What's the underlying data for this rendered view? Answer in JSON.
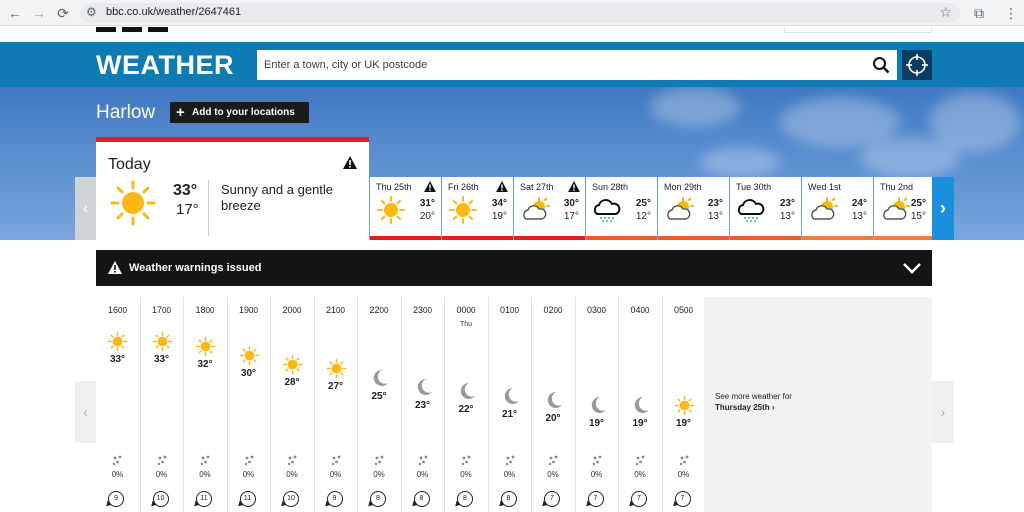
{
  "browser": {
    "url": "bbc.co.uk/weather/2647461",
    "back": "←",
    "forward": "→",
    "reload": "⟳",
    "star": "☆",
    "extensions": "⧉",
    "menu": "⋮"
  },
  "header": {
    "logo": "WEATHER",
    "search_placeholder": "Enter a town, city or UK postcode"
  },
  "location": {
    "name": "Harlow",
    "add_button": "Add to your locations"
  },
  "today": {
    "title": "Today",
    "high": "33°",
    "low": "17°",
    "description": "Sunny and a gentle breeze"
  },
  "days": [
    {
      "label": "Thu 25th",
      "high": "31°",
      "low": "20°",
      "icon": "sun-icon",
      "warning": true,
      "bar": "#e11d1d"
    },
    {
      "label": "Fri 26th",
      "high": "34°",
      "low": "19°",
      "icon": "sun-icon",
      "warning": true,
      "bar": "#e11d1d"
    },
    {
      "label": "Sat 27th",
      "high": "30°",
      "low": "17°",
      "icon": "sun-cloud-icon",
      "warning": true,
      "bar": "#e11d1d"
    },
    {
      "label": "Sun 28th",
      "high": "25°",
      "low": "12°",
      "icon": "rain-cloud-icon",
      "warning": false,
      "bar": "#f05a2b"
    },
    {
      "label": "Mon 29th",
      "high": "23°",
      "low": "13°",
      "icon": "sun-cloud-icon",
      "warning": false,
      "bar": "#f05a2b"
    },
    {
      "label": "Tue 30th",
      "high": "23°",
      "low": "13°",
      "icon": "rain-cloud-icon",
      "warning": false,
      "bar": "#f05a2b"
    },
    {
      "label": "Wed 1st",
      "high": "24°",
      "low": "13°",
      "icon": "sun-cloud-icon",
      "warning": false,
      "bar": "#f47b3a"
    },
    {
      "label": "Thu 2nd",
      "high": "25°",
      "low": "15°",
      "icon": "sun-cloud-icon",
      "warning": false,
      "bar": "#f47b3a"
    }
  ],
  "warnings": {
    "label": "Weather warnings issued"
  },
  "hours": [
    {
      "time": "16",
      "mins": "00",
      "sub": "",
      "icon": "sun-icon",
      "temp": "33°",
      "rain": "0%",
      "wind": "9"
    },
    {
      "time": "17",
      "mins": "00",
      "sub": "",
      "icon": "sun-icon",
      "temp": "33°",
      "rain": "0%",
      "wind": "10"
    },
    {
      "time": "18",
      "mins": "00",
      "sub": "",
      "icon": "sun-icon",
      "temp": "32°",
      "rain": "0%",
      "wind": "11"
    },
    {
      "time": "19",
      "mins": "00",
      "sub": "",
      "icon": "sun-icon",
      "temp": "30°",
      "rain": "0%",
      "wind": "11"
    },
    {
      "time": "20",
      "mins": "00",
      "sub": "",
      "icon": "sun-icon",
      "temp": "28°",
      "rain": "0%",
      "wind": "10"
    },
    {
      "time": "21",
      "mins": "00",
      "sub": "",
      "icon": "sun-icon",
      "temp": "27°",
      "rain": "0%",
      "wind": "9"
    },
    {
      "time": "22",
      "mins": "00",
      "sub": "",
      "icon": "moon-icon",
      "temp": "25°",
      "rain": "0%",
      "wind": "8"
    },
    {
      "time": "23",
      "mins": "00",
      "sub": "",
      "icon": "moon-icon",
      "temp": "23°",
      "rain": "0%",
      "wind": "8"
    },
    {
      "time": "00",
      "mins": "00",
      "sub": "Thu",
      "icon": "moon-icon",
      "temp": "22°",
      "rain": "0%",
      "wind": "8"
    },
    {
      "time": "01",
      "mins": "00",
      "sub": "",
      "icon": "moon-icon",
      "temp": "21°",
      "rain": "0%",
      "wind": "8"
    },
    {
      "time": "02",
      "mins": "00",
      "sub": "",
      "icon": "moon-icon",
      "temp": "20°",
      "rain": "0%",
      "wind": "7"
    },
    {
      "time": "03",
      "mins": "00",
      "sub": "",
      "icon": "moon-icon",
      "temp": "19°",
      "rain": "0%",
      "wind": "7"
    },
    {
      "time": "04",
      "mins": "00",
      "sub": "",
      "icon": "moon-icon",
      "temp": "19°",
      "rain": "0%",
      "wind": "7"
    },
    {
      "time": "05",
      "mins": "00",
      "sub": "",
      "icon": "sun-icon",
      "temp": "19°",
      "rain": "0%",
      "wind": "7"
    }
  ],
  "more": {
    "line1": "See more weather for",
    "line2": "Thursday 25th"
  },
  "colors": {
    "header_blue": "#0f7bb5",
    "sun": "#fdb813",
    "warning_red": "#e11d1d"
  }
}
